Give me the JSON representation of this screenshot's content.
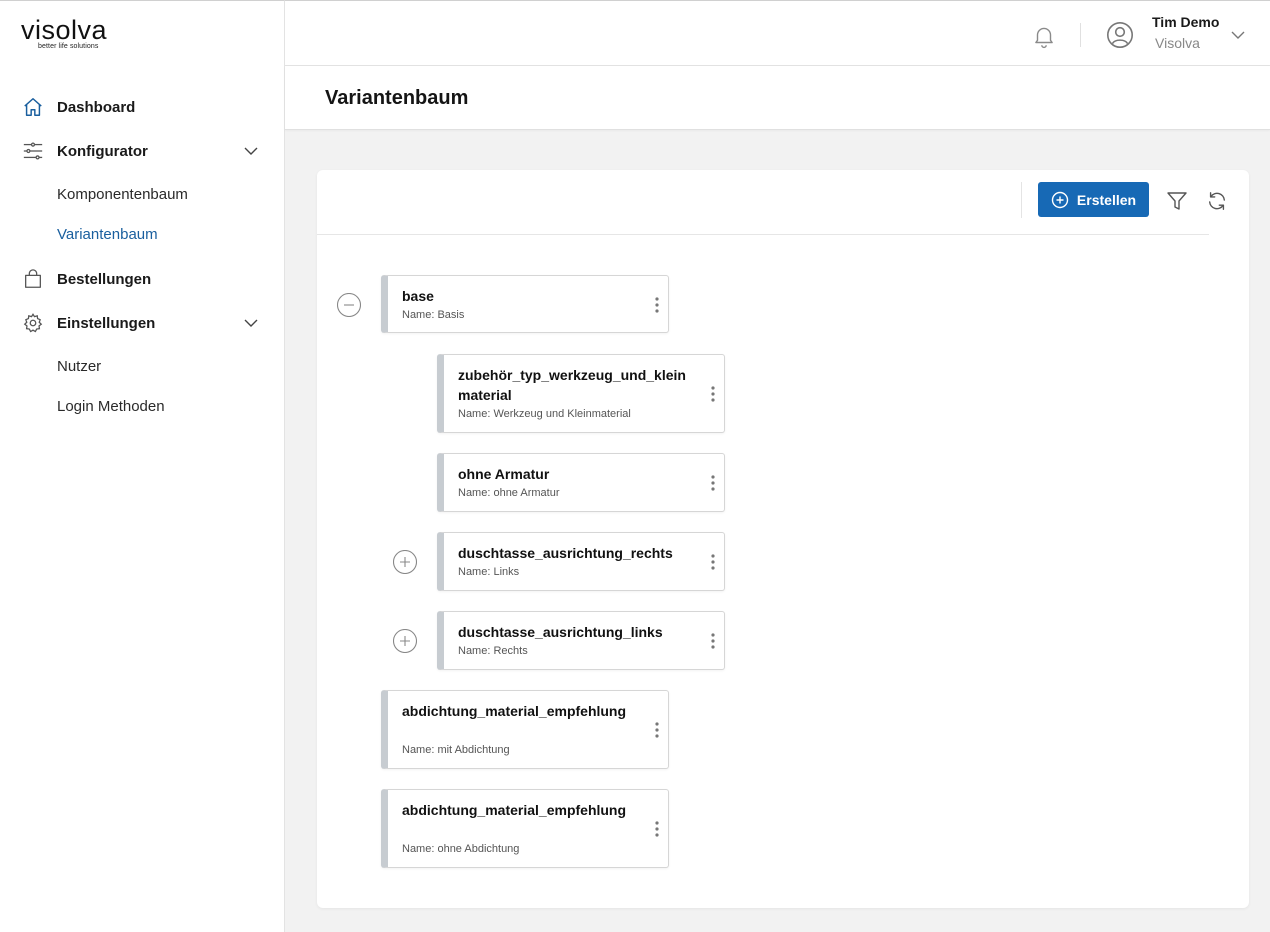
{
  "brand": {
    "word": "visolva",
    "tagline": "better life solutions"
  },
  "sidebar": {
    "items": [
      {
        "label": "Dashboard",
        "icon": "home-icon"
      },
      {
        "label": "Konfigurator",
        "icon": "sliders-icon",
        "expanded": true,
        "children": [
          {
            "label": "Komponentenbaum",
            "active": false
          },
          {
            "label": "Variantenbaum",
            "active": true
          }
        ]
      },
      {
        "label": "Bestellungen",
        "icon": "shopping-bag-icon"
      },
      {
        "label": "Einstellungen",
        "icon": "gear-icon",
        "expanded": true,
        "children": [
          {
            "label": "Nutzer",
            "active": false
          },
          {
            "label": "Login Methoden",
            "active": false
          }
        ]
      }
    ]
  },
  "header": {
    "user_name": "Tim Demo",
    "user_org": "Visolva"
  },
  "page": {
    "title": "Variantenbaum"
  },
  "toolbar": {
    "create_label": "Erstellen"
  },
  "tree": {
    "nodes": [
      {
        "key": "base",
        "name": "Name: Basis",
        "level": 0,
        "toggle": "collapse"
      },
      {
        "key": "zubehör_typ_werkzeug_und_kleinmaterial",
        "name": "Name: Werkzeug und Kleinmaterial",
        "level": 1,
        "toggle": "none"
      },
      {
        "key": "ohne Armatur",
        "name": "Name: ohne Armatur",
        "level": 1,
        "toggle": "none"
      },
      {
        "key": "duschtasse_ausrichtung_rechts",
        "name": "Name: Links",
        "level": 1,
        "toggle": "expand"
      },
      {
        "key": "duschtasse_ausrichtung_links",
        "name": "Name: Rechts",
        "level": 1,
        "toggle": "expand"
      },
      {
        "key": "abdichtung_material_empfehlung",
        "name": "Name: mit Abdichtung",
        "level": 0,
        "toggle": "none"
      },
      {
        "key": "abdichtung_material_empfehlung",
        "name": "Name: ohne Abdichtung",
        "level": 0,
        "toggle": "none"
      }
    ]
  },
  "colors": {
    "accent": "#1769b5",
    "active_link": "#1a5f9e",
    "node_strip": "#c7ccd1"
  }
}
